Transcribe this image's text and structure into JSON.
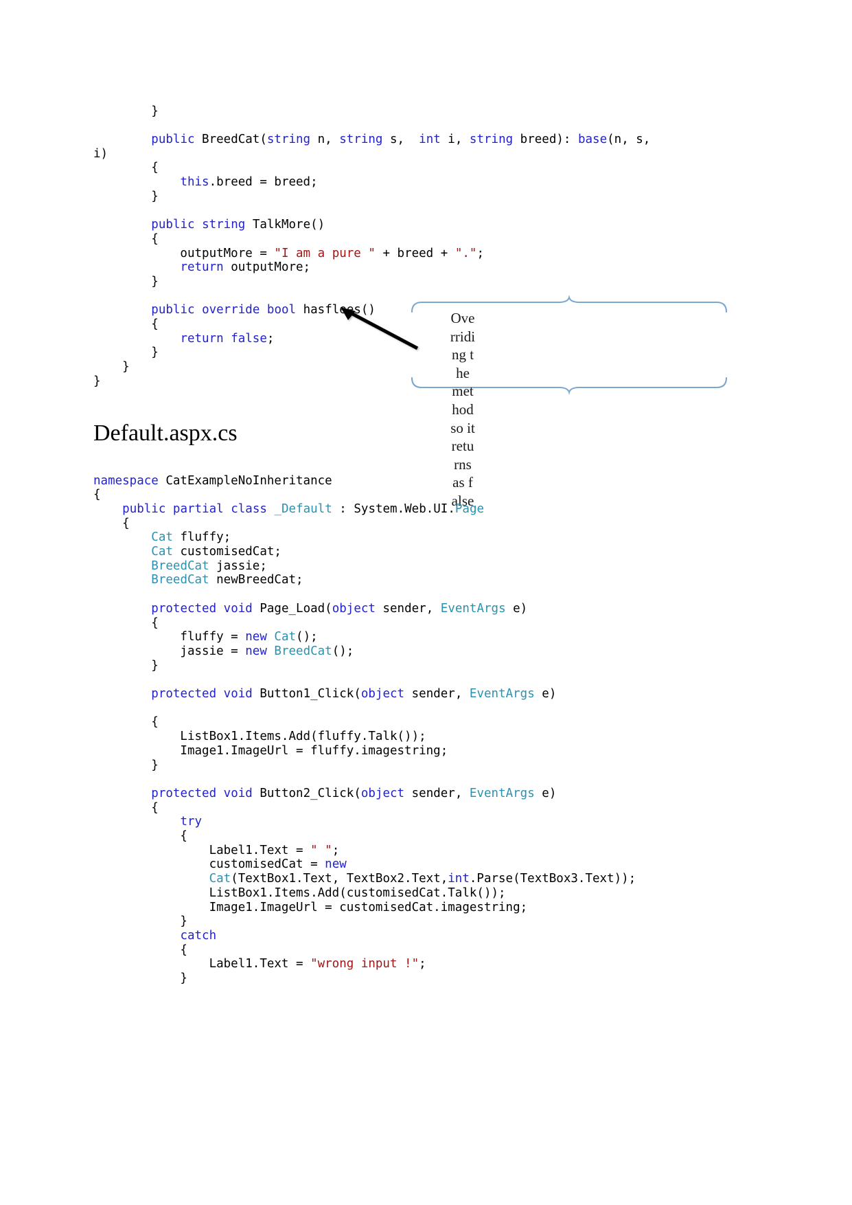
{
  "document": {
    "heading": "Default.aspx.cs"
  },
  "code_top": {
    "lines": [
      [
        {
          "t": "        }",
          "c": "pl"
        }
      ],
      [
        {
          "t": "",
          "c": "pl"
        }
      ],
      [
        {
          "t": "        ",
          "c": "pl"
        },
        {
          "t": "public",
          "c": "kw"
        },
        {
          "t": " BreedCat(",
          "c": "pl"
        },
        {
          "t": "string",
          "c": "kw"
        },
        {
          "t": " n, ",
          "c": "pl"
        },
        {
          "t": "string",
          "c": "kw"
        },
        {
          "t": " s,  ",
          "c": "pl"
        },
        {
          "t": "int",
          "c": "kw"
        },
        {
          "t": " i, ",
          "c": "pl"
        },
        {
          "t": "string",
          "c": "kw"
        },
        {
          "t": " breed): ",
          "c": "pl"
        },
        {
          "t": "base",
          "c": "kw"
        },
        {
          "t": "(n, s,",
          "c": "pl"
        }
      ],
      [
        {
          "t": "i)",
          "c": "pl"
        }
      ],
      [
        {
          "t": "        {",
          "c": "pl"
        }
      ],
      [
        {
          "t": "            ",
          "c": "pl"
        },
        {
          "t": "this",
          "c": "kw"
        },
        {
          "t": ".breed = breed;",
          "c": "pl"
        }
      ],
      [
        {
          "t": "        }",
          "c": "pl"
        }
      ],
      [
        {
          "t": "",
          "c": "pl"
        }
      ],
      [
        {
          "t": "        ",
          "c": "pl"
        },
        {
          "t": "public",
          "c": "kw"
        },
        {
          "t": " ",
          "c": "pl"
        },
        {
          "t": "string",
          "c": "kw"
        },
        {
          "t": " TalkMore()",
          "c": "pl"
        }
      ],
      [
        {
          "t": "        {",
          "c": "pl"
        }
      ],
      [
        {
          "t": "            outputMore = ",
          "c": "pl"
        },
        {
          "t": "\"I am a pure \"",
          "c": "str"
        },
        {
          "t": " + breed + ",
          "c": "pl"
        },
        {
          "t": "\".\"",
          "c": "str"
        },
        {
          "t": ";",
          "c": "pl"
        }
      ],
      [
        {
          "t": "            ",
          "c": "pl"
        },
        {
          "t": "return",
          "c": "kw"
        },
        {
          "t": " outputMore;",
          "c": "pl"
        }
      ],
      [
        {
          "t": "        }",
          "c": "pl"
        }
      ],
      [
        {
          "t": "",
          "c": "pl"
        }
      ],
      [
        {
          "t": "        ",
          "c": "pl"
        },
        {
          "t": "public",
          "c": "kw"
        },
        {
          "t": " ",
          "c": "pl"
        },
        {
          "t": "override",
          "c": "kw"
        },
        {
          "t": " ",
          "c": "pl"
        },
        {
          "t": "bool",
          "c": "kw"
        },
        {
          "t": " hasflees()",
          "c": "pl"
        }
      ],
      [
        {
          "t": "        {",
          "c": "pl"
        }
      ],
      [
        {
          "t": "            ",
          "c": "pl"
        },
        {
          "t": "return",
          "c": "kw"
        },
        {
          "t": " ",
          "c": "pl"
        },
        {
          "t": "false",
          "c": "kw"
        },
        {
          "t": ";",
          "c": "pl"
        }
      ],
      [
        {
          "t": "        }",
          "c": "pl"
        }
      ],
      [
        {
          "t": "    }",
          "c": "pl"
        }
      ],
      [
        {
          "t": "}",
          "c": "pl"
        }
      ]
    ]
  },
  "callout": {
    "text": "Overriding the method so it returns as false",
    "stroke_color": "#7ba7ce",
    "shape": "double-brace"
  },
  "arrow": {
    "color": "#000000",
    "points_to": "hasflees-method"
  },
  "code_bottom": {
    "lines": [
      [
        {
          "t": "namespace",
          "c": "kw"
        },
        {
          "t": " CatExampleNoInheritance",
          "c": "pl"
        }
      ],
      [
        {
          "t": "{",
          "c": "pl"
        }
      ],
      [
        {
          "t": "    ",
          "c": "pl"
        },
        {
          "t": "public",
          "c": "kw"
        },
        {
          "t": " ",
          "c": "pl"
        },
        {
          "t": "partial",
          "c": "kw"
        },
        {
          "t": " ",
          "c": "pl"
        },
        {
          "t": "class",
          "c": "kw"
        },
        {
          "t": " ",
          "c": "pl"
        },
        {
          "t": "_Default",
          "c": "type"
        },
        {
          "t": " : System.Web.UI.",
          "c": "pl"
        },
        {
          "t": "Page",
          "c": "type"
        }
      ],
      [
        {
          "t": "    {",
          "c": "pl"
        }
      ],
      [
        {
          "t": "        ",
          "c": "pl"
        },
        {
          "t": "Cat",
          "c": "type"
        },
        {
          "t": " fluffy;",
          "c": "pl"
        }
      ],
      [
        {
          "t": "        ",
          "c": "pl"
        },
        {
          "t": "Cat",
          "c": "type"
        },
        {
          "t": " customisedCat;",
          "c": "pl"
        }
      ],
      [
        {
          "t": "        ",
          "c": "pl"
        },
        {
          "t": "BreedCat",
          "c": "type"
        },
        {
          "t": " jassie;",
          "c": "pl"
        }
      ],
      [
        {
          "t": "        ",
          "c": "pl"
        },
        {
          "t": "BreedCat",
          "c": "type"
        },
        {
          "t": " newBreedCat;",
          "c": "pl"
        }
      ],
      [
        {
          "t": "",
          "c": "pl"
        }
      ],
      [
        {
          "t": "        ",
          "c": "pl"
        },
        {
          "t": "protected",
          "c": "kw"
        },
        {
          "t": " ",
          "c": "pl"
        },
        {
          "t": "void",
          "c": "kw"
        },
        {
          "t": " Page_Load(",
          "c": "pl"
        },
        {
          "t": "object",
          "c": "kw"
        },
        {
          "t": " sender, ",
          "c": "pl"
        },
        {
          "t": "EventArgs",
          "c": "type"
        },
        {
          "t": " e)",
          "c": "pl"
        }
      ],
      [
        {
          "t": "        {",
          "c": "pl"
        }
      ],
      [
        {
          "t": "            fluffy = ",
          "c": "pl"
        },
        {
          "t": "new",
          "c": "kw"
        },
        {
          "t": " ",
          "c": "pl"
        },
        {
          "t": "Cat",
          "c": "type"
        },
        {
          "t": "();",
          "c": "pl"
        }
      ],
      [
        {
          "t": "            jassie = ",
          "c": "pl"
        },
        {
          "t": "new",
          "c": "kw"
        },
        {
          "t": " ",
          "c": "pl"
        },
        {
          "t": "BreedCat",
          "c": "type"
        },
        {
          "t": "();",
          "c": "pl"
        }
      ],
      [
        {
          "t": "        }",
          "c": "pl"
        }
      ],
      [
        {
          "t": "",
          "c": "pl"
        }
      ],
      [
        {
          "t": "        ",
          "c": "pl"
        },
        {
          "t": "protected",
          "c": "kw"
        },
        {
          "t": " ",
          "c": "pl"
        },
        {
          "t": "void",
          "c": "kw"
        },
        {
          "t": " Button1_Click(",
          "c": "pl"
        },
        {
          "t": "object",
          "c": "kw"
        },
        {
          "t": " sender, ",
          "c": "pl"
        },
        {
          "t": "EventArgs",
          "c": "type"
        },
        {
          "t": " e)",
          "c": "pl"
        }
      ],
      [
        {
          "t": "",
          "c": "pl"
        }
      ],
      [
        {
          "t": "        {",
          "c": "pl"
        }
      ],
      [
        {
          "t": "            ListBox1.Items.Add(fluffy.Talk());",
          "c": "pl"
        }
      ],
      [
        {
          "t": "            Image1.ImageUrl = fluffy.imagestring;",
          "c": "pl"
        }
      ],
      [
        {
          "t": "        }",
          "c": "pl"
        }
      ],
      [
        {
          "t": "",
          "c": "pl"
        }
      ],
      [
        {
          "t": "        ",
          "c": "pl"
        },
        {
          "t": "protected",
          "c": "kw"
        },
        {
          "t": " ",
          "c": "pl"
        },
        {
          "t": "void",
          "c": "kw"
        },
        {
          "t": " Button2_Click(",
          "c": "pl"
        },
        {
          "t": "object",
          "c": "kw"
        },
        {
          "t": " sender, ",
          "c": "pl"
        },
        {
          "t": "EventArgs",
          "c": "type"
        },
        {
          "t": " e)",
          "c": "pl"
        }
      ],
      [
        {
          "t": "        {",
          "c": "pl"
        }
      ],
      [
        {
          "t": "            ",
          "c": "pl"
        },
        {
          "t": "try",
          "c": "kw"
        }
      ],
      [
        {
          "t": "            {",
          "c": "pl"
        }
      ],
      [
        {
          "t": "                Label1.Text = ",
          "c": "pl"
        },
        {
          "t": "\" \"",
          "c": "str"
        },
        {
          "t": ";",
          "c": "pl"
        }
      ],
      [
        {
          "t": "                customisedCat = ",
          "c": "pl"
        },
        {
          "t": "new",
          "c": "kw"
        }
      ],
      [
        {
          "t": "                ",
          "c": "pl"
        },
        {
          "t": "Cat",
          "c": "type"
        },
        {
          "t": "(TextBox1.Text, TextBox2.Text,",
          "c": "pl"
        },
        {
          "t": "int",
          "c": "kw"
        },
        {
          "t": ".Parse(TextBox3.Text));",
          "c": "pl"
        }
      ],
      [
        {
          "t": "                ListBox1.Items.Add(customisedCat.Talk());",
          "c": "pl"
        }
      ],
      [
        {
          "t": "                Image1.ImageUrl = customisedCat.imagestring;",
          "c": "pl"
        }
      ],
      [
        {
          "t": "            }",
          "c": "pl"
        }
      ],
      [
        {
          "t": "            ",
          "c": "pl"
        },
        {
          "t": "catch",
          "c": "kw"
        }
      ],
      [
        {
          "t": "            {",
          "c": "pl"
        }
      ],
      [
        {
          "t": "                Label1.Text = ",
          "c": "pl"
        },
        {
          "t": "\"wrong input !\"",
          "c": "str"
        },
        {
          "t": ";",
          "c": "pl"
        }
      ],
      [
        {
          "t": "            }",
          "c": "pl"
        }
      ]
    ]
  }
}
